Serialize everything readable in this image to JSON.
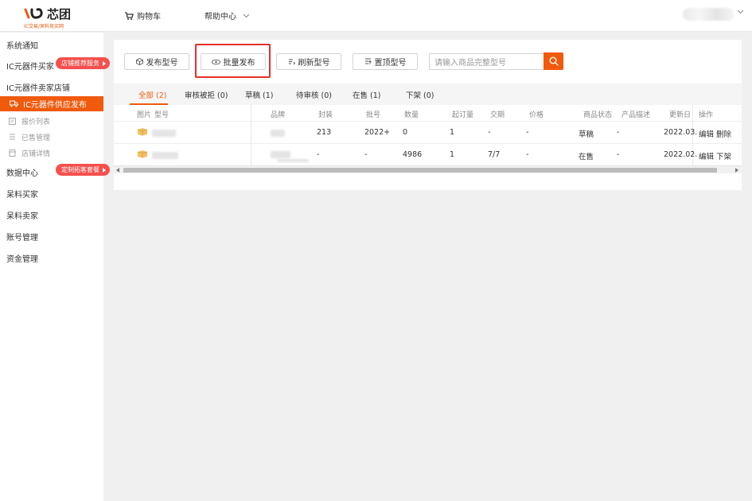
{
  "header": {
    "logo_text": "芯团",
    "logo_sub": "IC交易/呆料竞买网",
    "cart_label": "购物车",
    "help_label": "帮助中心"
  },
  "sidebar": {
    "items": [
      {
        "label": "系统通知"
      },
      {
        "label": "IC元器件买家",
        "badge": "店铺推荐服务"
      },
      {
        "label": "IC元器件卖家店铺"
      },
      {
        "label": "IC元器件供应发布",
        "active": true
      },
      {
        "label": "报价列表",
        "icon": "list-icon"
      },
      {
        "label": "已售管理",
        "icon": "sold-icon"
      },
      {
        "label": "店铺详情",
        "icon": "store-icon"
      },
      {
        "label": "数据中心",
        "badge": "定制拓客套餐"
      },
      {
        "label": "呆料买家"
      },
      {
        "label": "呆料卖家"
      },
      {
        "label": "账号管理"
      },
      {
        "label": "资金管理"
      }
    ]
  },
  "toolbar": {
    "publish": "发布型号",
    "batch_publish": "批量发布",
    "refresh": "刷新型号",
    "top": "置顶型号",
    "search_placeholder": "请输入商品完整型号"
  },
  "tabs": [
    {
      "label": "全部 (2)",
      "active": true
    },
    {
      "label": "审核被拒 (0)"
    },
    {
      "label": "草稿 (1)"
    },
    {
      "label": "待审核 (0)"
    },
    {
      "label": "在售 (1)"
    },
    {
      "label": "下架 (0)"
    }
  ],
  "table": {
    "headers": [
      "图片",
      "型号",
      "品牌",
      "封装",
      "批号",
      "数量",
      "起订量",
      "交期",
      "价格",
      "商品状态",
      "产品描述",
      "更新日",
      "操作"
    ],
    "rows": [
      {
        "package": "213",
        "batch": "2022+",
        "qty": "0",
        "moq": "1",
        "lead": "-",
        "price": "-",
        "status": "草稿",
        "desc": "-",
        "updated": "2022.03.",
        "action1": "编辑",
        "action2": "删除"
      },
      {
        "package": "-",
        "batch": "-",
        "qty": "4986",
        "moq": "1",
        "lead": "7/7",
        "price": "-",
        "status": "在售",
        "desc": "-",
        "updated": "2022.02.",
        "action1": "编辑",
        "action2": "下架"
      }
    ]
  },
  "colors": {
    "accent": "#f05a0c",
    "badge": "#f4514e",
    "highlight": "#e4302b"
  }
}
